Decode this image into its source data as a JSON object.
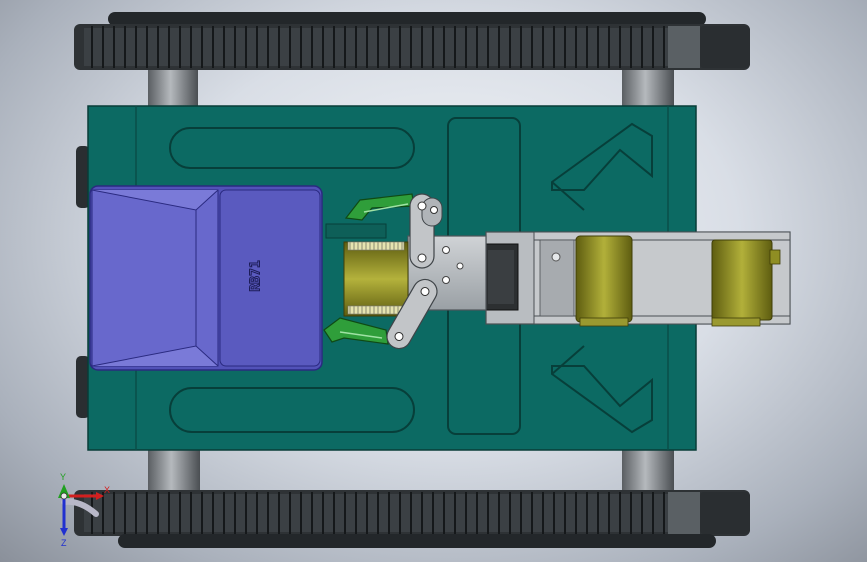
{
  "model": {
    "body_label": "RB71",
    "colors": {
      "chassis": "#0c6a63",
      "chassis_edge": "#0a4e49",
      "track": "#2e3235",
      "bucket": "#6a6ad0",
      "bucket_side": "#5858c0",
      "gripper": "#2f9e3a",
      "cylinder": "#8f8e23",
      "bracket": "#b8bcc0",
      "axle": "#8d9195"
    }
  },
  "triad": {
    "x_label": "X",
    "y_label": "Y",
    "z_label": "Z",
    "x_color": "#d21f1f",
    "y_color": "#20a020",
    "z_color": "#2030d0"
  }
}
